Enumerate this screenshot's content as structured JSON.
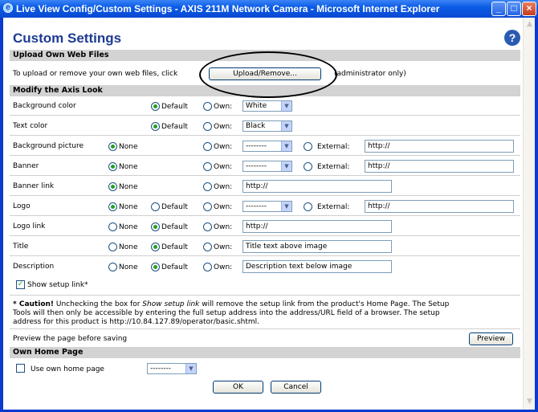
{
  "window": {
    "title": "Live View Config/Custom Settings - AXIS 211M Network Camera - Microsoft Internet Explorer"
  },
  "page": {
    "title": "Custom Settings",
    "help": "?"
  },
  "upload": {
    "header": "Upload Own Web Files",
    "text": "To upload or remove your own web files, click",
    "button": "Upload/Remove...",
    "note": "(administrator only)"
  },
  "look": {
    "header": "Modify the Axis Look",
    "rows": {
      "bg_color": {
        "label": "Background color",
        "default": "Default",
        "own": "Own:",
        "value": "White"
      },
      "text_color": {
        "label": "Text color",
        "default": "Default",
        "own": "Own:",
        "value": "Black"
      },
      "bg_picture": {
        "label": "Background picture",
        "none": "None",
        "own": "Own:",
        "value": "--------",
        "external": "External:",
        "url": "http://"
      },
      "banner": {
        "label": "Banner",
        "none": "None",
        "own": "Own:",
        "value": "--------",
        "external": "External:",
        "url": "http://"
      },
      "banner_link": {
        "label": "Banner link",
        "none": "None",
        "own": "Own:",
        "url": "http://"
      },
      "logo": {
        "label": "Logo",
        "none": "None",
        "default": "Default",
        "own": "Own:",
        "value": "--------",
        "external": "External:",
        "url": "http://"
      },
      "logo_link": {
        "label": "Logo link",
        "none": "None",
        "default": "Default",
        "own": "Own:",
        "url": "http://"
      },
      "title": {
        "label": "Title",
        "none": "None",
        "default": "Default",
        "own": "Own:",
        "text": "Title text above image"
      },
      "description": {
        "label": "Description",
        "none": "None",
        "default": "Default",
        "own": "Own:",
        "text": "Description text below image"
      }
    },
    "show_setup": "Show setup link*",
    "caution_bold": "* Caution!",
    "caution_line1_pre": " Unchecking the box for ",
    "caution_line1_italic": "Show setup link",
    "caution_line1_post": " will remove the setup link from the product's Home Page. The Setup",
    "caution_line2": "Tools will then only be accessible by entering the full setup address into the address/URL field of a browser. The setup",
    "caution_line3": "address for this product is http://10.84.127.89/operator/basic.shtml."
  },
  "preview": {
    "text": "Preview the page before saving",
    "button": "Preview"
  },
  "home": {
    "header": "Own Home Page",
    "checkbox": "Use own home page",
    "value": "--------"
  },
  "actions": {
    "ok": "OK",
    "cancel": "Cancel"
  }
}
